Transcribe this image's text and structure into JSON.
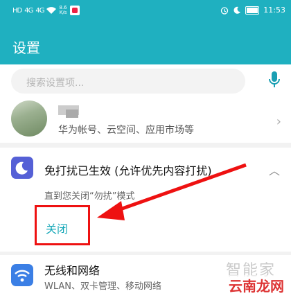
{
  "status_bar": {
    "signal1": "HD",
    "signal2": "4G",
    "signal3": "4G",
    "rate": "8.6\nK/s",
    "time": "11:53"
  },
  "header": {
    "title": "设置"
  },
  "search": {
    "placeholder": "搜索设置项..."
  },
  "account": {
    "subtitle": "华为帐号、云空间、应用市场等"
  },
  "dnd": {
    "title": "免打扰已生效 (允许优先内容打扰)",
    "description": "直到您关闭“勿扰”模式",
    "close_label": "关闭"
  },
  "wifi": {
    "title": "无线和网络",
    "subtitle": "WLAN、双卡管理、移动网络"
  },
  "watermark": {
    "line1": "智能家",
    "line2": "云南龙网"
  },
  "colors": {
    "header": "#1fb0c0",
    "accent": "#15a7b7",
    "dnd_icon": "#5560d6",
    "wifi_icon": "#3b7fe5",
    "highlight": "#e11111"
  }
}
